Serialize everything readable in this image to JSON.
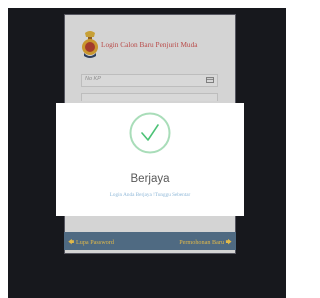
{
  "login": {
    "title": "Login Calon Baru Penjurit Muda",
    "ic_placeholder": "No KP"
  },
  "footer": {
    "forgot_label": "Lupa Password",
    "new_application_label": "Permohonan Baru"
  },
  "dialog": {
    "title": "Berjaya",
    "message": "Login Anda Berjaya !Tunggu Sebentar",
    "icon": "success-check-icon"
  },
  "colors": {
    "accent_success": "#4cc276",
    "title_red": "#b94a48",
    "footer_bar": "#4f6a82",
    "footer_link": "#e1b94a",
    "message_blue": "#8fb8d8"
  }
}
